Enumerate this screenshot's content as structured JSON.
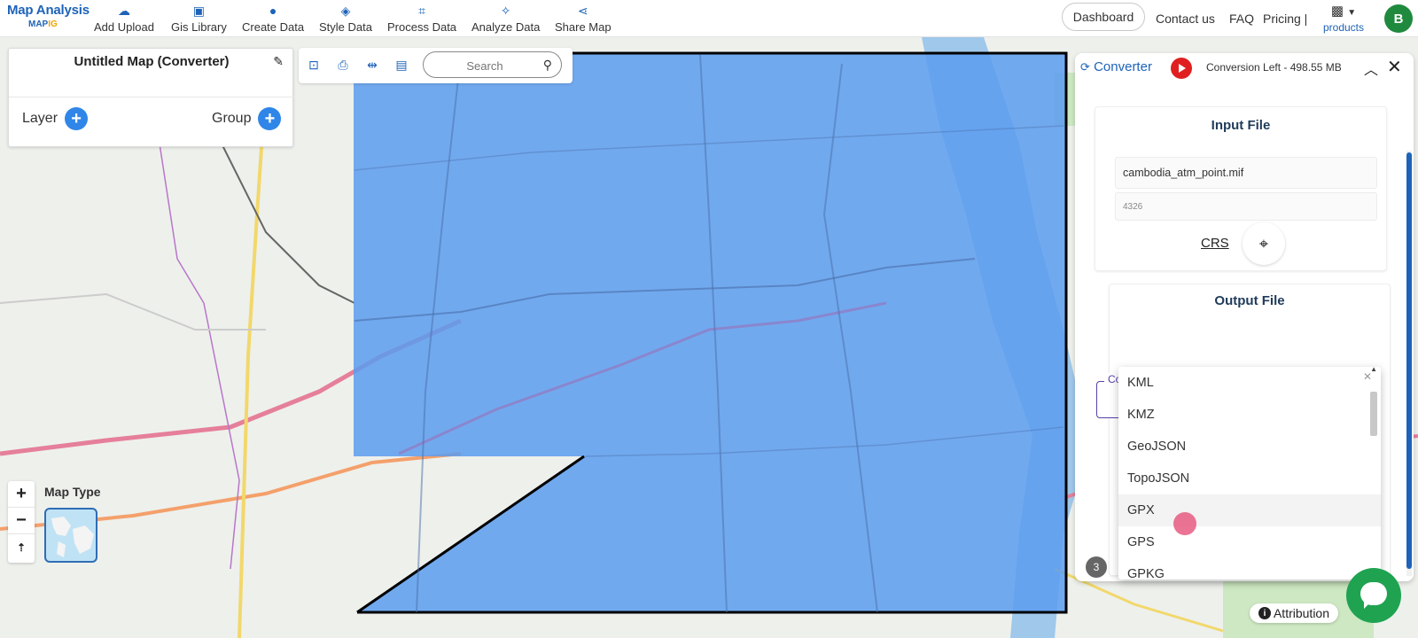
{
  "brand": {
    "line1": "Map Analysis",
    "line2": "MAP",
    "line2_accent": "IG"
  },
  "nav": [
    {
      "label": "Add Upload",
      "icon": "cloud-upload-icon"
    },
    {
      "label": "Gis Library",
      "icon": "library-icon"
    },
    {
      "label": "Create Data",
      "icon": "map-pin-icon"
    },
    {
      "label": "Style Data",
      "icon": "paint-bucket-icon"
    },
    {
      "label": "Process Data",
      "icon": "process-icon"
    },
    {
      "label": "Analyze Data",
      "icon": "analyze-icon"
    },
    {
      "label": "Share Map",
      "icon": "share-icon"
    }
  ],
  "right_nav": {
    "dashboard": "Dashboard",
    "contact": "Contact us",
    "faq": "FAQ",
    "pricing": "Pricing |",
    "products": "products",
    "avatar": "B"
  },
  "left_panel": {
    "title": "Untitled Map (Converter)",
    "layer": "Layer",
    "group": "Group"
  },
  "toolbar": {
    "search_placeholder": "Search"
  },
  "map": {
    "map_type_label": "Map Type",
    "attribution": "Attribution",
    "badge": "3"
  },
  "converter": {
    "title": "Converter",
    "conversion_left": "Conversion Left - 498.55 MB",
    "input_title": "Input File",
    "input_file": "cambodia_atm_point.mif",
    "crs_value": "4326",
    "crs_label": "CRS",
    "output_title": "Output File",
    "convert_to_label": "Convert To *",
    "options": [
      "KML",
      "KMZ",
      "GeoJSON",
      "TopoJSON",
      "GPX",
      "GPS",
      "GPKG"
    ],
    "hovered_option": "GPX"
  },
  "colors": {
    "brand_blue": "#1e63b8",
    "polygon_fill": "#5b9cf0",
    "select_border": "#5a3fa8",
    "chat_green": "#1fa351"
  }
}
